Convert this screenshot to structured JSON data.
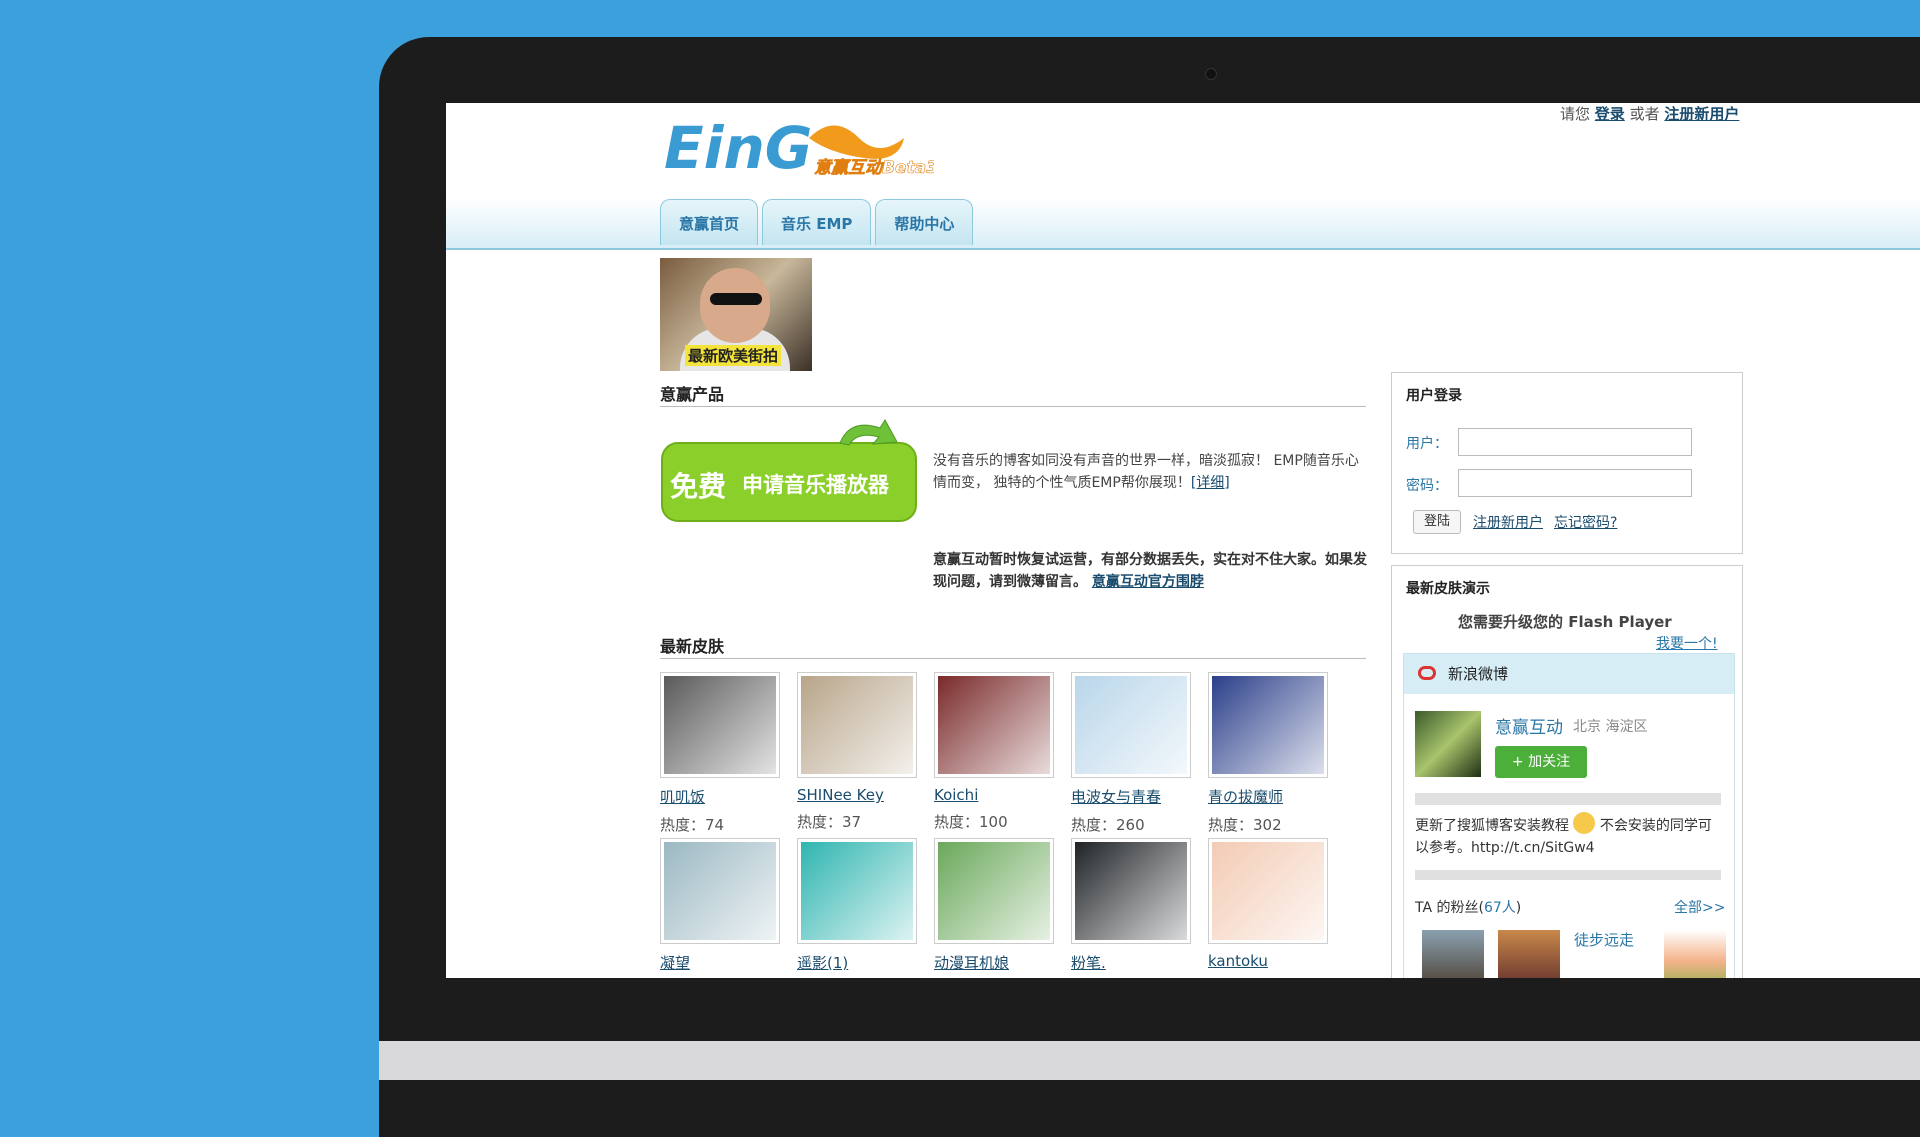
{
  "header": {
    "login_prompt": "请您",
    "login_link": "登录",
    "or_text": "或者",
    "register_link": "注册新用户",
    "logo_text": "EinG",
    "logo_subtitle": "意赢互动Beta3"
  },
  "tabs": [
    {
      "label": "意赢首页"
    },
    {
      "label": "音乐 EMP"
    },
    {
      "label": "帮助中心"
    }
  ],
  "banner": {
    "caption": "最新欧美街拍"
  },
  "products": {
    "title": "意赢产品",
    "promo_free": "免费",
    "promo_text": "申请音乐播放器",
    "description": "没有音乐的博客如同没有声音的世界一样，暗淡孤寂！ EMP随音乐心情而变， 独特的个性气质EMP帮你展现！",
    "detail_link": "[详细]",
    "notice": "意赢互动暂时恢复试运营，有部分数据丢失，实在对不住大家。如果发现问题，请到微薄留言。",
    "notice_link": "意赢互动官方围脖"
  },
  "skins": {
    "title": "最新皮肤",
    "items": [
      {
        "name": "叽叽饭",
        "heat": "热度：74",
        "color": "#5a5a5a"
      },
      {
        "name": "SHINee Key",
        "heat": "热度：37",
        "color": "#b8a58a"
      },
      {
        "name": "Koichi",
        "heat": "热度：100",
        "color": "#7a2a2a"
      },
      {
        "name": "电波女与青春",
        "heat": "热度：260",
        "color": "#b9d6ea"
      },
      {
        "name": "青の拔魔师",
        "heat": "热度：302",
        "color": "#2b3f8a"
      },
      {
        "name": "凝望",
        "heat": "",
        "color": "#9bb8c2"
      },
      {
        "name": "遥影(1)",
        "heat": "",
        "color": "#2fb5b0"
      },
      {
        "name": "动漫耳机娘",
        "heat": "",
        "color": "#6aa85a"
      },
      {
        "name": "粉笔.",
        "heat": "",
        "color": "#1f2326"
      },
      {
        "name": "kantoku",
        "heat": "",
        "color": "#f3cbb4"
      }
    ]
  },
  "login_panel": {
    "title": "用户登录",
    "user_label": "用户：",
    "password_label": "密码：",
    "login_button": "登陆",
    "register_link": "注册新用户",
    "forgot_link": "忘记密码?"
  },
  "skin_demo": {
    "title": "最新皮肤演示",
    "flash_message": "您需要升级您的 Flash Player",
    "want_link": "我要一个!"
  },
  "weibo": {
    "title": "新浪微博",
    "name": "意赢互动",
    "location": "北京 海淀区",
    "follow_label": "+ 加关注",
    "post_before": "更新了搜狐博客安装教程",
    "post_after": "不会安装的同学可以参考。http://t.cn/SitGw4",
    "fans_label": "TA 的粉丝(",
    "fans_count": "67人",
    "fans_close": ")",
    "fans_all": "全部>>",
    "fan_alt": "徒步远走"
  }
}
